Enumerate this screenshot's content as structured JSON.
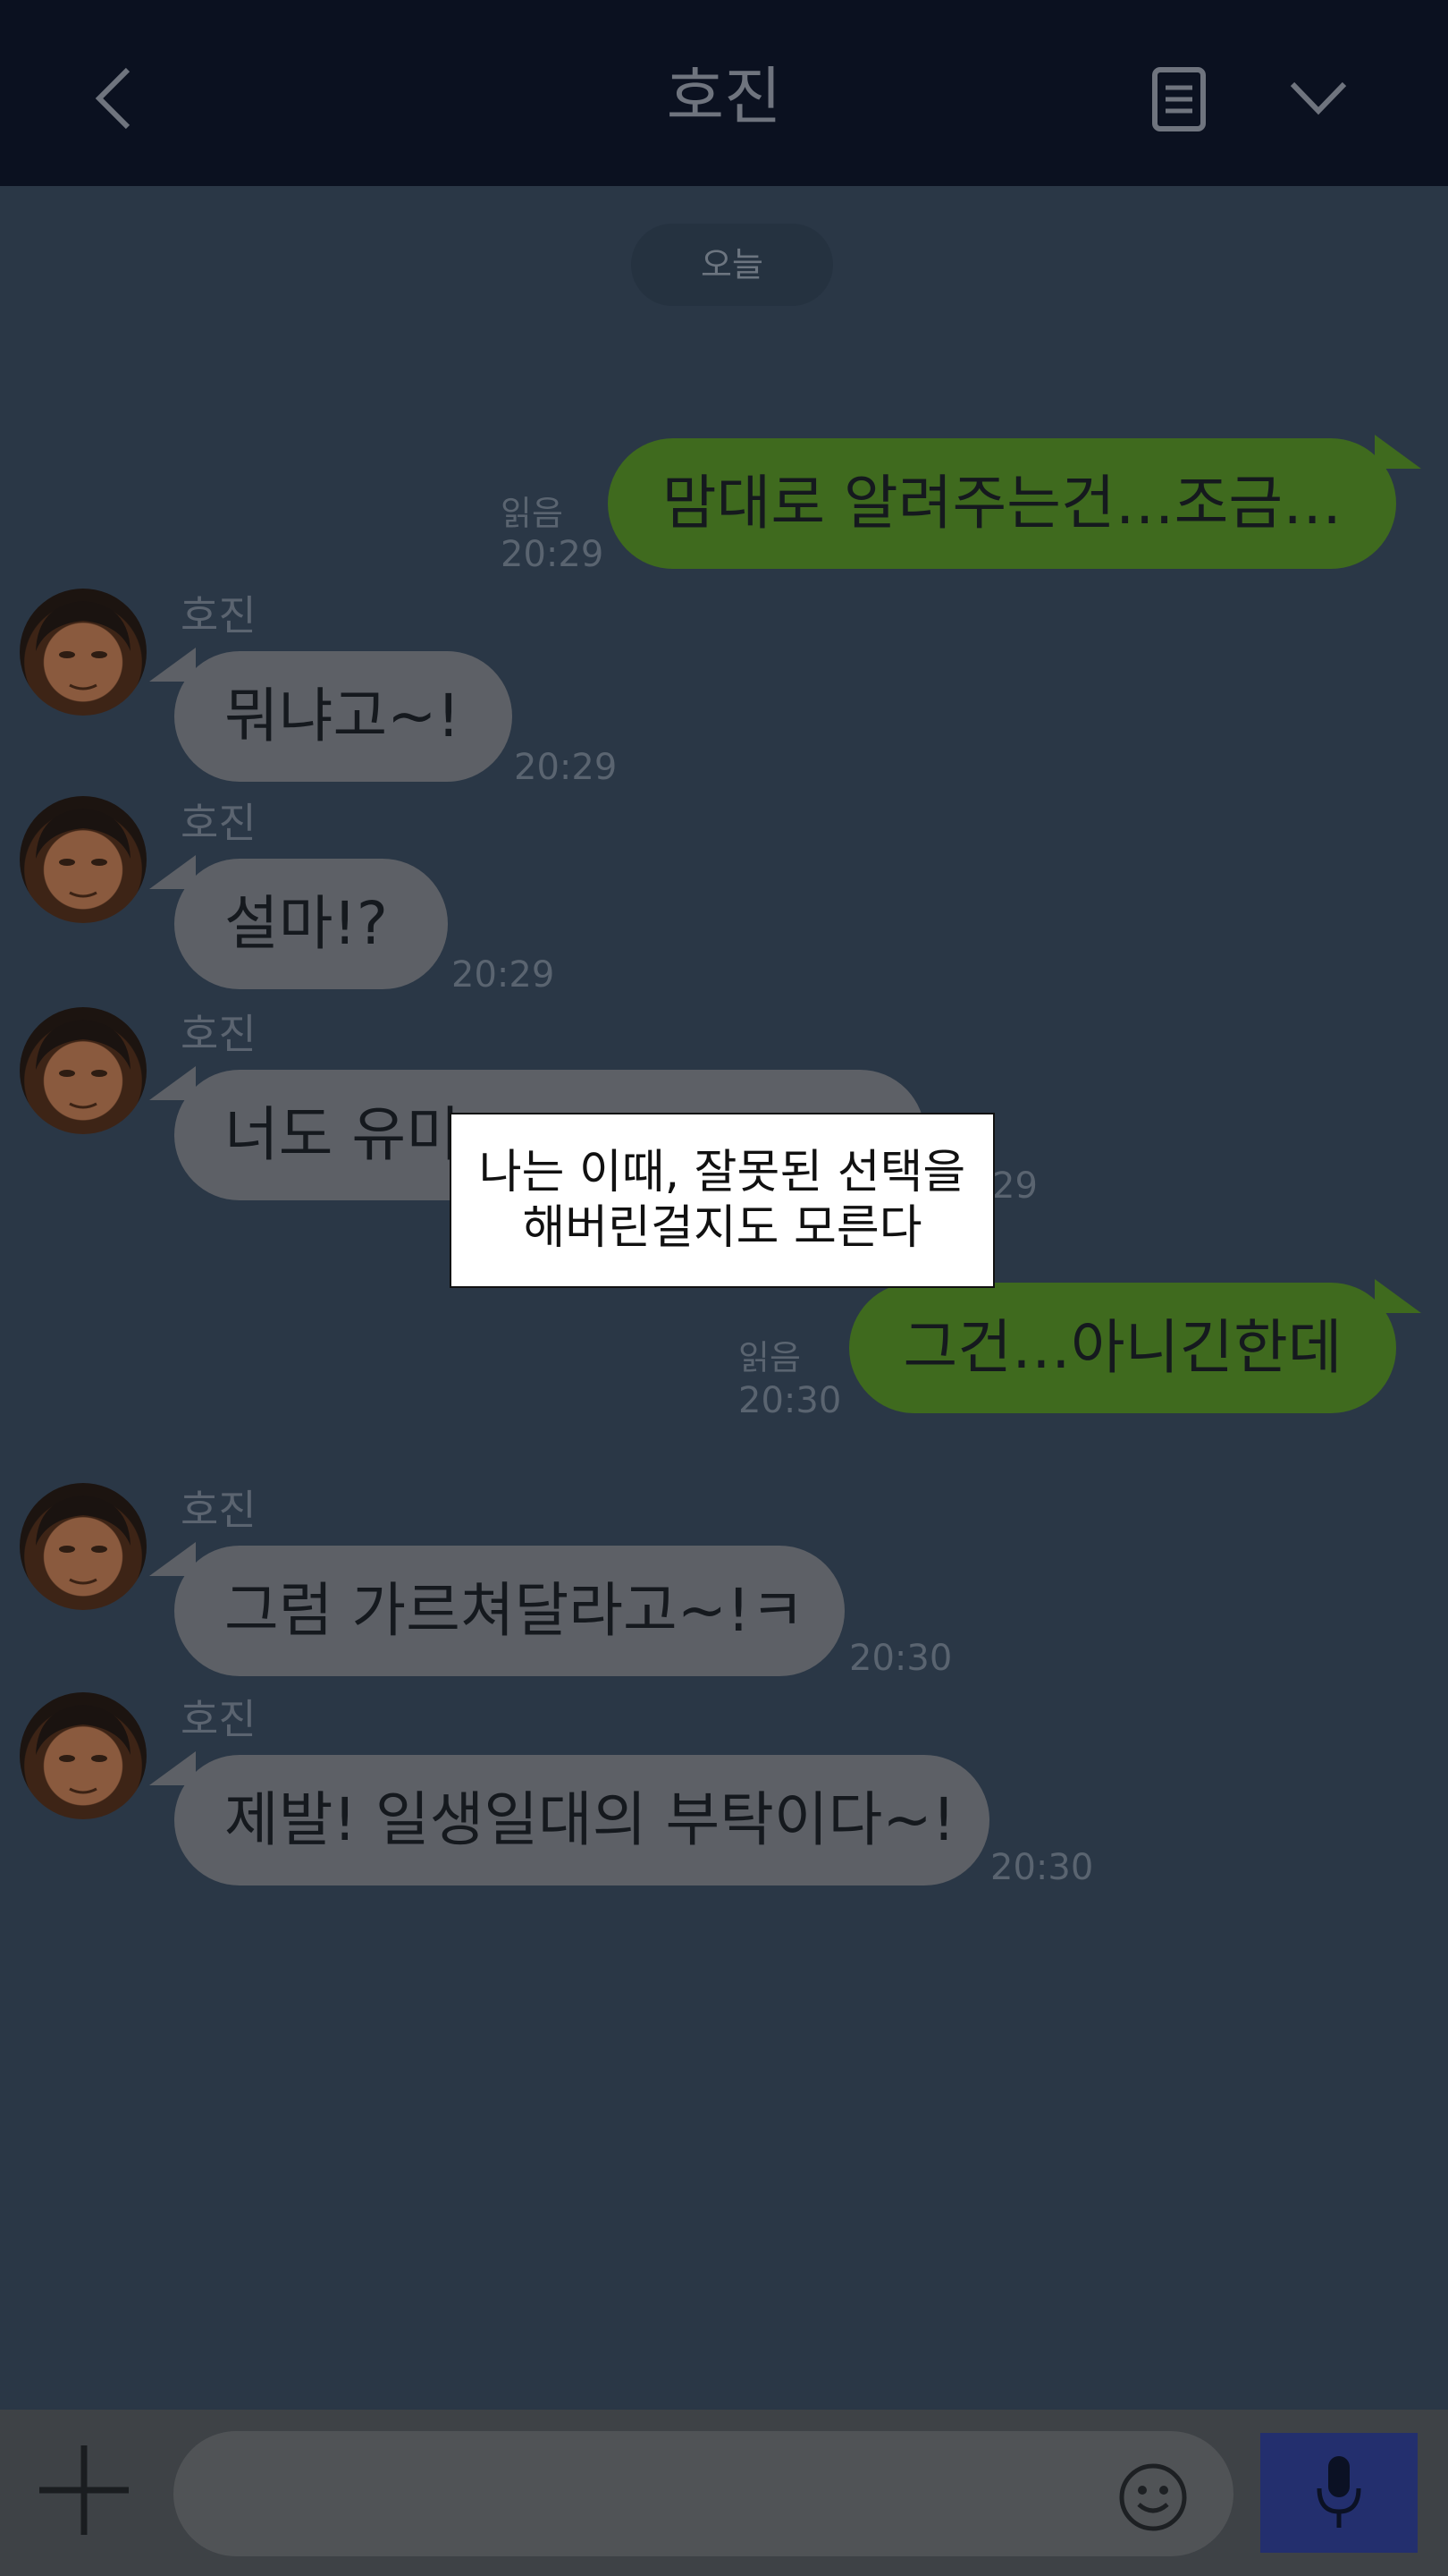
{
  "header": {
    "title": "호진"
  },
  "chat": {
    "date_label": "오늘",
    "messages": [
      {
        "side": "out",
        "text": "맘대로 알려주는건…조금…",
        "read": "읽음",
        "time": "20:29"
      },
      {
        "side": "in",
        "sender": "호진",
        "text": "뭐냐고~!",
        "time": "20:29"
      },
      {
        "side": "in",
        "sender": "호진",
        "text": "설마!?",
        "time": "20:29"
      },
      {
        "side": "in",
        "sender": "호진",
        "text": "너도 유미",
        "time": "29"
      },
      {
        "side": "out",
        "text": "그건…아니긴한데",
        "read": "읽음",
        "time": "20:30"
      },
      {
        "side": "in",
        "sender": "호진",
        "text": "그럼 가르쳐달라고~!ㅋ",
        "time": "20:30"
      },
      {
        "side": "in",
        "sender": "호진",
        "text": "제발! 일생일대의 부탁이다~!",
        "time": "20:30"
      }
    ]
  },
  "caption": {
    "line1": "나는 이때, 잘못된 선택을",
    "line2": "해버린걸지도 모른다"
  },
  "icons": {
    "back": "chevron-left-icon",
    "document": "document-icon",
    "collapse": "chevron-down-icon",
    "plus": "plus-icon",
    "emoji": "smiley-icon",
    "mic": "microphone-icon"
  },
  "colors": {
    "outgoing_bubble": "#3f6a1e",
    "incoming_bubble": "#5d6066",
    "mic_button": "#232f6e"
  }
}
